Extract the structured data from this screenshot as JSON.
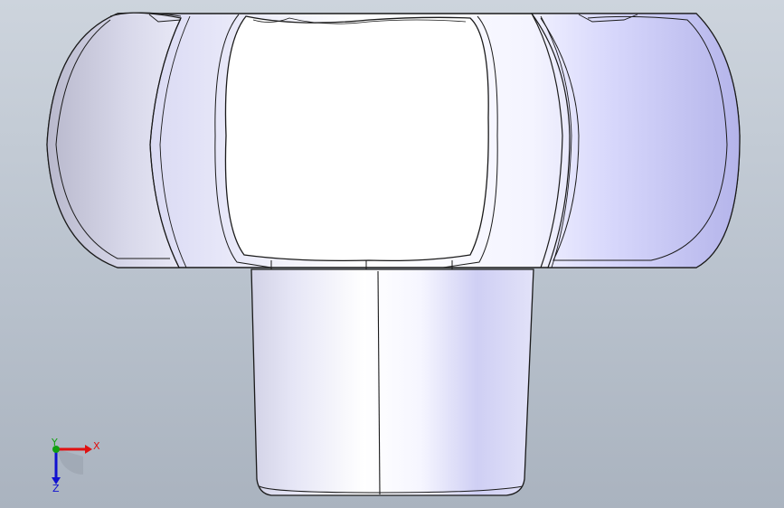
{
  "viewport": {
    "background_top": "#cdd4dd",
    "background_bottom": "#aab3bf"
  },
  "model": {
    "name_icon": "knob-3d-model",
    "body_color": "#e8e8fa",
    "shade_color": "#b9b9e6",
    "edge_color": "#1a1a1a"
  },
  "triad": {
    "x_label": "X",
    "y_label": "Y",
    "z_label": "Z",
    "x_color": "#e01010",
    "y_color": "#10a010",
    "z_color": "#1010d0"
  }
}
